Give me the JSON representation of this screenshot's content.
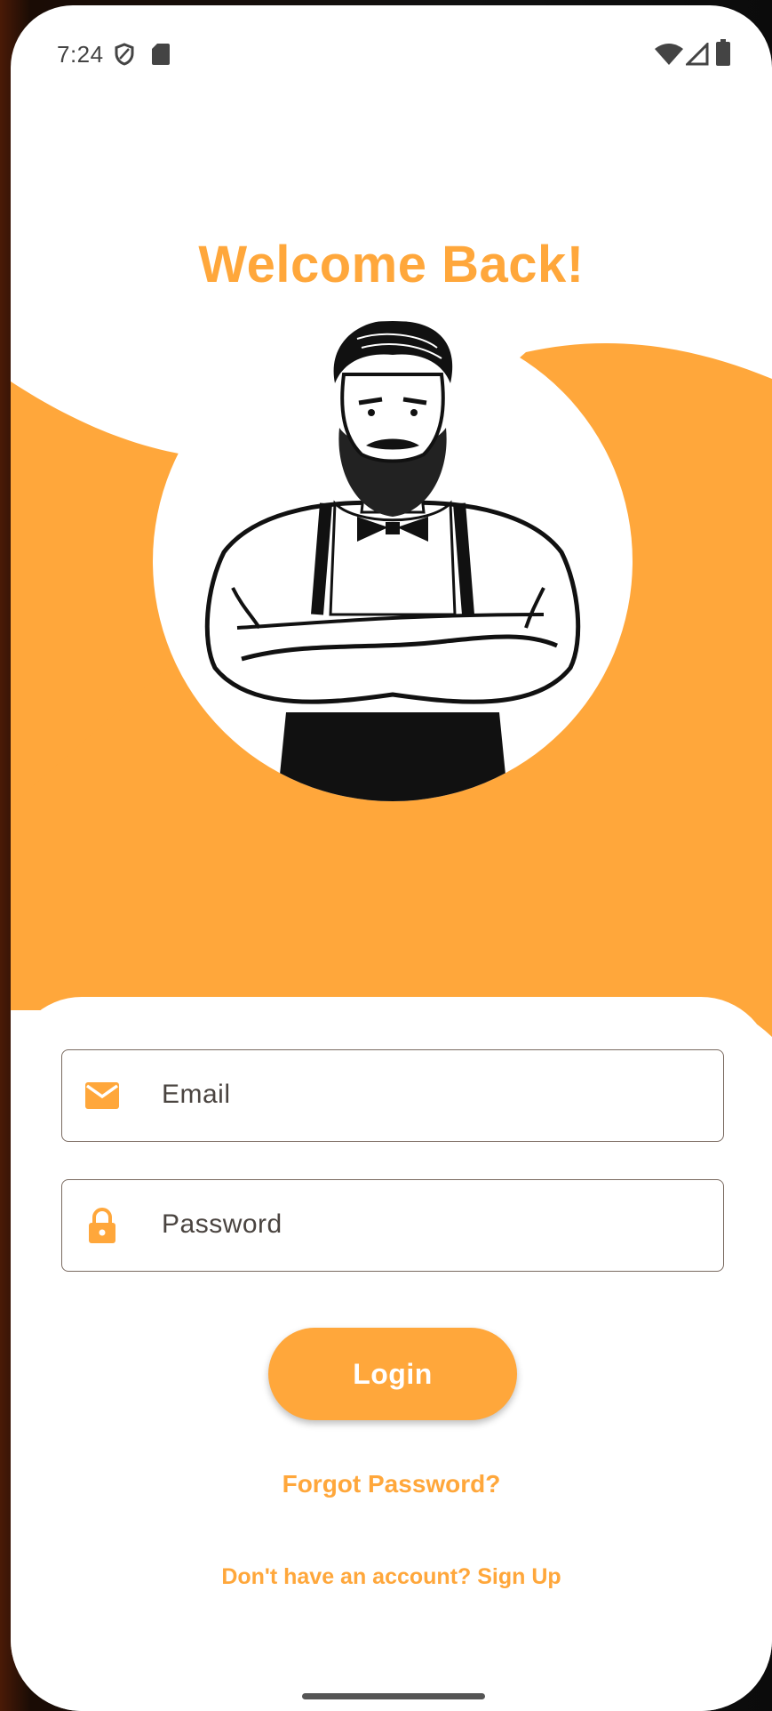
{
  "status_bar": {
    "time": "7:24",
    "left_icons": [
      "shield-icon",
      "sd-card-icon"
    ],
    "right_icons": [
      "wifi-icon",
      "cell-signal-icon",
      "battery-icon"
    ]
  },
  "colors": {
    "accent": "#FFA73B",
    "background": "#FFFFFF",
    "field_border": "#7A6A60",
    "text": "#4A4440"
  },
  "login": {
    "title": "Welcome Back!",
    "illustration": "bearded-man-illustration",
    "email": {
      "placeholder": "Email",
      "icon": "mail-icon"
    },
    "password": {
      "placeholder": "Password",
      "icon": "lock-icon"
    },
    "login_label": "Login",
    "forgot_label": "Forgot Password?",
    "signup_label": "Don't have an account? Sign Up"
  }
}
